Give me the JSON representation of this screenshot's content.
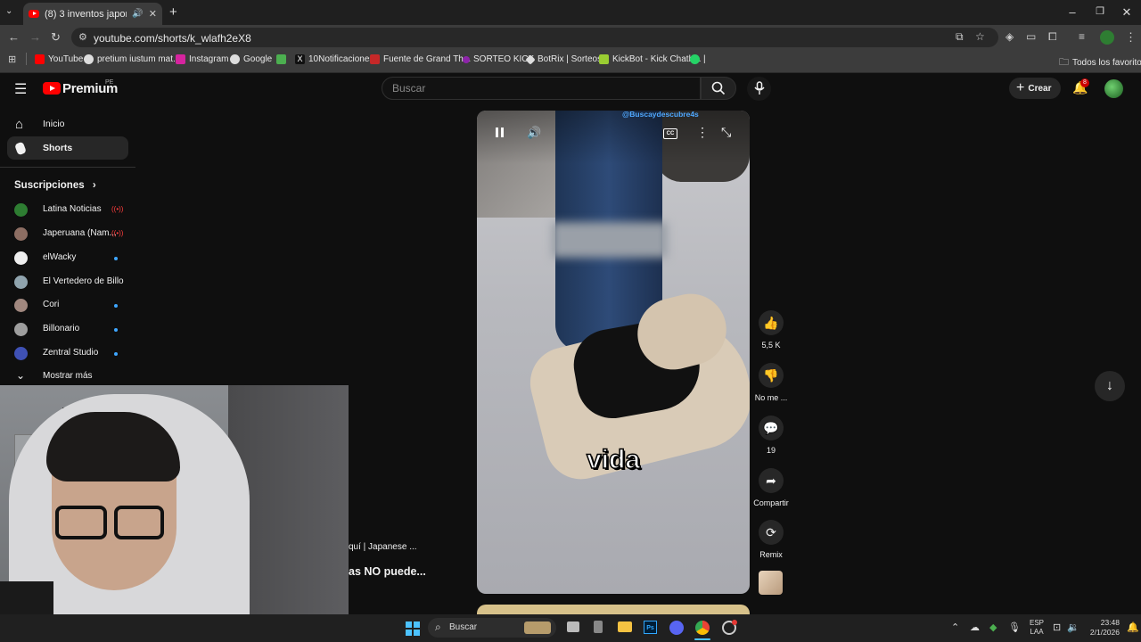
{
  "browser": {
    "tab_title": "(8) 3 inventos japoneses qu",
    "new_tab": "+",
    "url": "youtube.com/shorts/k_wlafh2eX8",
    "bookmarks": [
      {
        "label": "YouTube",
        "color": "#ff0000"
      },
      {
        "label": "pretium iustum mat...",
        "color": "#dddddd"
      },
      {
        "label": "Instagram",
        "color": "#d6249f"
      },
      {
        "label": "Google",
        "color": "#dddddd"
      },
      {
        "label": "",
        "color": "#4caf50"
      },
      {
        "label": "10Notificaciones",
        "color": "#111111"
      },
      {
        "label": "Fuente de Grand Th...",
        "color": "#c62828"
      },
      {
        "label": "SORTEO KICK",
        "color": "#8e24aa"
      },
      {
        "label": "BotRix | Sorteos",
        "color": "#dddddd"
      },
      {
        "label": "KickBot - Kick Chatb...",
        "color": "#9acd32"
      },
      {
        "label": "|",
        "color": "#25d366"
      }
    ],
    "all_bookmarks": "Todos los favoritos"
  },
  "youtube": {
    "logo": "Premium",
    "region": "PE",
    "search_placeholder": "Buscar",
    "create_label": "Crear",
    "notif_count": "8",
    "sidebar": {
      "items": [
        {
          "label": "Inicio",
          "icon": "home-icon"
        },
        {
          "label": "Shorts",
          "icon": "shorts-icon"
        }
      ],
      "subscriptions_title": "Suscripciones",
      "subscriptions": [
        {
          "name": "Latina Noticias",
          "color": "#2e7d32",
          "status": "live"
        },
        {
          "name": "Japeruana (Nam...",
          "color": "#8d6e63",
          "status": "live"
        },
        {
          "name": "elWacky",
          "color": "#eeeeee",
          "status": "new"
        },
        {
          "name": "El Vertedero de Billo",
          "color": "#90a4ae",
          "status": ""
        },
        {
          "name": "Cori",
          "color": "#a1887f",
          "status": "new"
        },
        {
          "name": "Billonario",
          "color": "#9e9e9e",
          "status": "new"
        },
        {
          "name": "Zentral Studio",
          "color": "#3f51b5",
          "status": "new"
        }
      ],
      "show_more": "Mostrar más"
    },
    "short": {
      "channel_watermark": "@Buscaydescubre4s",
      "caption": "vida",
      "title_line1": "quí | Japanese ...",
      "title_line2": "as NO puede..."
    },
    "actions": {
      "likes": "5,5 K",
      "dislike": "No me ...",
      "comments": "19",
      "share": "Compartir",
      "remix": "Remix"
    }
  },
  "taskbar": {
    "search": "Buscar",
    "lang1": "ESP",
    "lang2": "LAA",
    "time": "23:48",
    "date": "2/1/2026"
  }
}
